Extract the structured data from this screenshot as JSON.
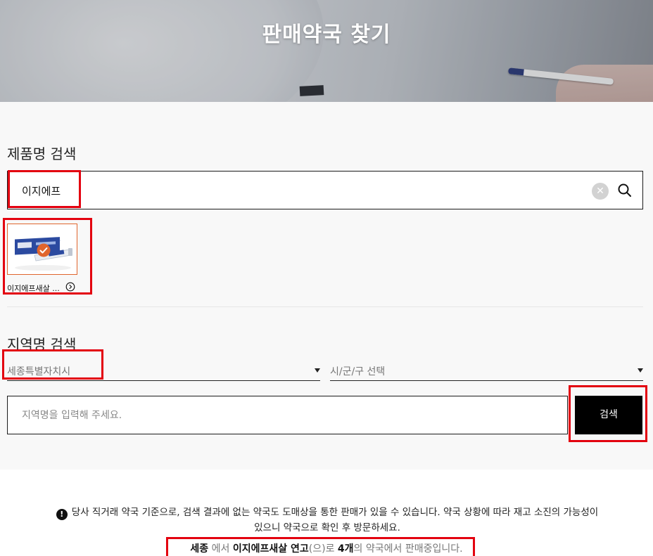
{
  "hero": {
    "title": "판매약국 찾기"
  },
  "product_search": {
    "label": "제품명 검색",
    "query": "이지에프",
    "clear_icon": "close-icon",
    "search_icon": "search-icon"
  },
  "products": [
    {
      "name": "이지에프새살 ...",
      "selected": true,
      "arrow_icon": "chevron-right-circle-icon"
    }
  ],
  "region_search": {
    "label": "지역명 검색",
    "province_selected": "세종특별자치시",
    "district_placeholder": "시/군/구 선택",
    "input_placeholder": "지역명을 입력해 주세요.",
    "submit_label": "검색"
  },
  "notice": {
    "icon": "exclamation-icon",
    "text_line1": "당사 직거래 약국 기준으로, 검색 결과에 없는 약국도 도매상을 통한 판매가 있을 수 있습니다. 약국 상황에 따라 재고 소진의 가능성이",
    "text_line2": "있으니 약국으로 확인 후 방문하세요."
  },
  "result": {
    "region": "세종",
    "part1": " 에서 ",
    "product": "이지에프새살 연고",
    "part2": "(으)로 ",
    "count": "4개",
    "part3": "의 약국에서 판매중입니다."
  },
  "colors": {
    "accent": "#e0652d",
    "highlight": "#e3000f",
    "button_bg": "#000000"
  }
}
